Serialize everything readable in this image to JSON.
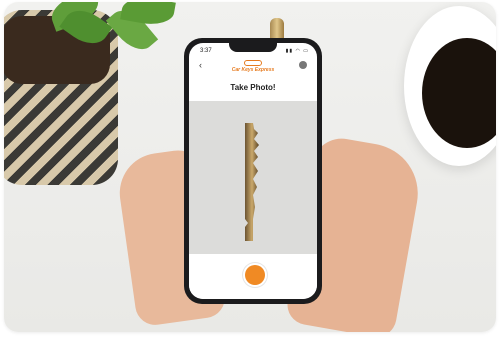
{
  "app": {
    "status_time": "3:37",
    "status_icons": "▮▮ ◠ ▭",
    "back_label": "‹",
    "logo_text": "Car Keys Express",
    "title": "Take Photo!",
    "icons": {
      "back": "chevron-left-icon",
      "profile": "user-icon",
      "shutter": "camera-shutter-icon"
    },
    "colors": {
      "accent": "#f08a24",
      "logo": "#e67a1e",
      "viewfinder_bg": "#dcdcda"
    }
  }
}
